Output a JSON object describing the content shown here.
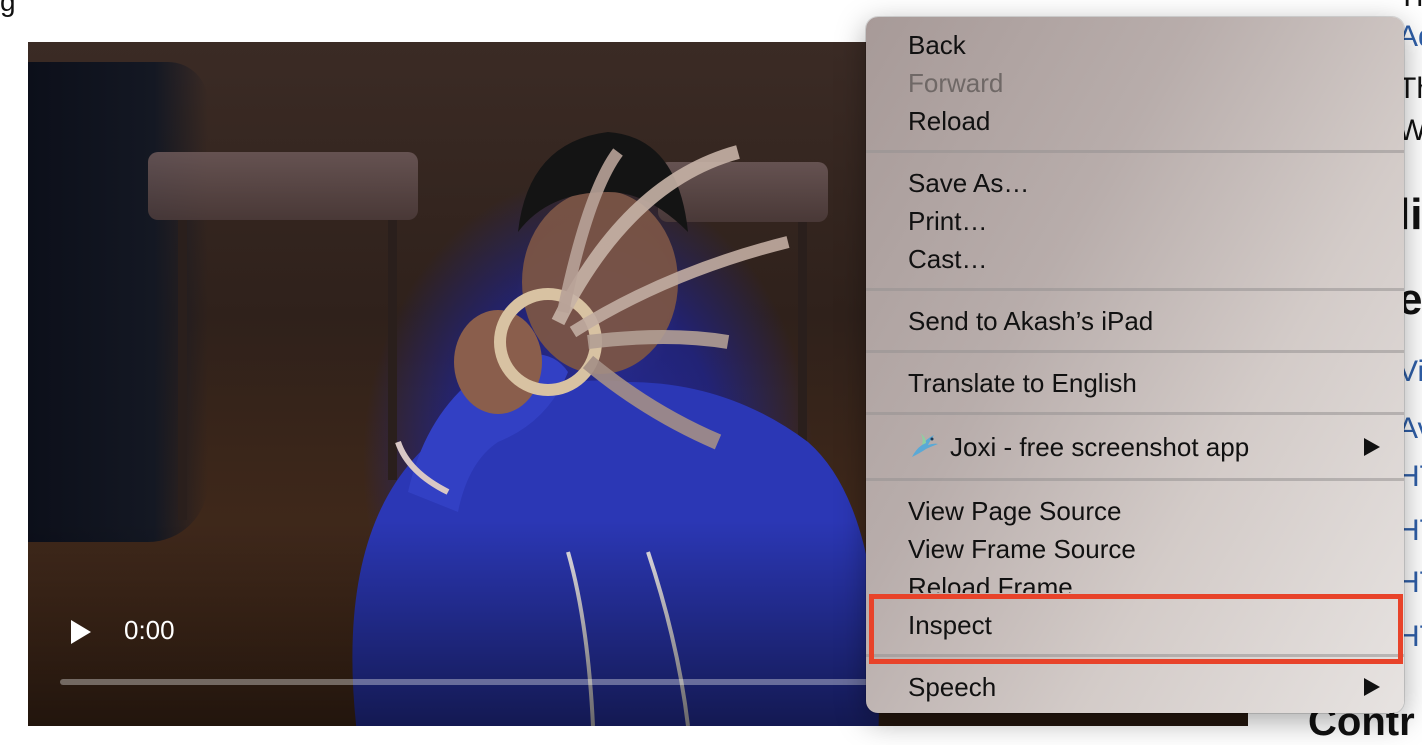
{
  "page": {
    "top_cut_text": "g",
    "right_fragments": [
      {
        "text": "Th",
        "style": "dark"
      },
      {
        "text": "Ad",
        "style": "link"
      },
      {
        "text": "Th",
        "style": "dark"
      },
      {
        "text": "We",
        "style": "dark"
      },
      {
        "text": "li",
        "style": "big"
      },
      {
        "text": "er",
        "style": "big"
      },
      {
        "text": "Vid",
        "style": "link"
      },
      {
        "text": "Av",
        "style": "link"
      },
      {
        "text": "HT",
        "style": "link"
      },
      {
        "text": "HT",
        "style": "link"
      },
      {
        "text": "HT",
        "style": "link"
      },
      {
        "text": "HT",
        "style": "link"
      }
    ],
    "bottom_heading": "Contr"
  },
  "video": {
    "time": "0:00",
    "progress": 0
  },
  "context_menu": {
    "items": {
      "back": "Back",
      "forward": "Forward",
      "reload": "Reload",
      "save_as": "Save As…",
      "print": "Print…",
      "cast": "Cast…",
      "send_to": "Send to Akash’s iPad",
      "translate": "Translate to English",
      "joxi": "Joxi - free screenshot app",
      "view_page_source": "View Page Source",
      "view_frame_source": "View Frame Source",
      "reload_frame": "Reload Frame",
      "inspect": "Inspect",
      "speech": "Speech"
    },
    "joxi_icon": "hummingbird-icon",
    "highlight_color": "#e8432a"
  }
}
